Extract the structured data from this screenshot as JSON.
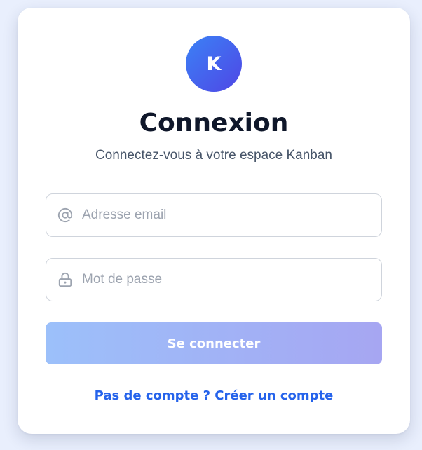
{
  "logo": {
    "letter": "K"
  },
  "header": {
    "title": "Connexion",
    "subtitle": "Connectez-vous à votre espace Kanban"
  },
  "form": {
    "email": {
      "placeholder": "Adresse email",
      "value": "",
      "icon": "at-sign-icon"
    },
    "password": {
      "placeholder": "Mot de passe",
      "value": "",
      "icon": "lock-icon"
    },
    "submit_label": "Se connecter"
  },
  "footer": {
    "signup_link": "Pas de compte ? Créer un compte"
  },
  "colors": {
    "page_background": "#e9effd",
    "brand_gradient_start": "#3b82f6",
    "brand_gradient_end": "#4f46e5",
    "link": "#2563eb"
  }
}
